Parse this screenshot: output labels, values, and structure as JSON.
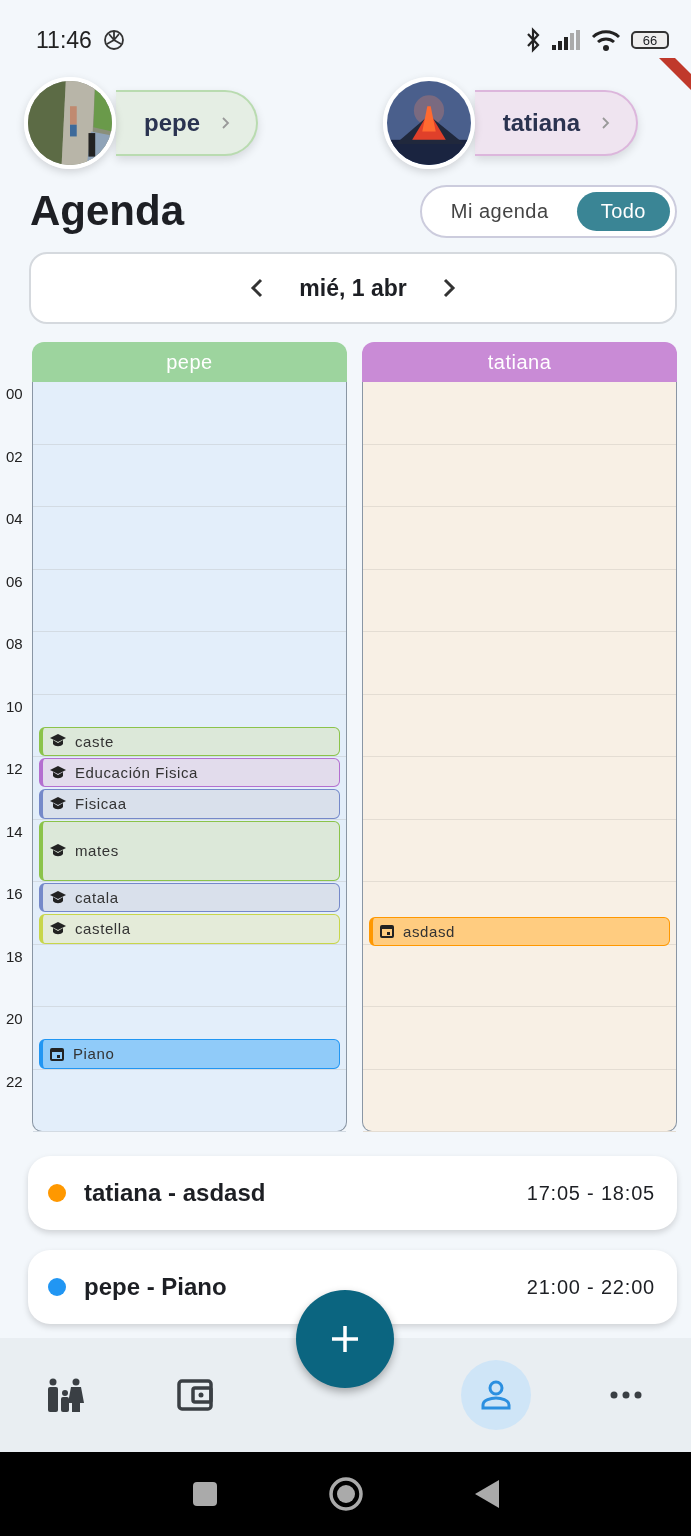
{
  "status_bar": {
    "time": "11:46",
    "battery": "66"
  },
  "profiles": [
    {
      "name": "pepe",
      "color": "#b9dbb0"
    },
    {
      "name": "tatiana",
      "color": "#dcb6dc"
    }
  ],
  "title": "Agenda",
  "view_toggle": [
    {
      "label": "Mi agenda",
      "selected": false
    },
    {
      "label": "Todo",
      "selected": true
    }
  ],
  "date_nav": {
    "date": "mié, 1 abr"
  },
  "hours": [
    "00",
    "02",
    "04",
    "06",
    "08",
    "10",
    "12",
    "14",
    "16",
    "18",
    "20",
    "22"
  ],
  "columns": [
    {
      "name": "pepe",
      "color": "#9dd49e",
      "events": [
        {
          "kind": "class",
          "title": "caste",
          "color": "#8bc34a"
        },
        {
          "kind": "class",
          "title": "Educación Fisica",
          "color": "#b46fd0"
        },
        {
          "kind": "class",
          "title": "Fisicaa",
          "color": "#7589c9"
        },
        {
          "kind": "class",
          "title": "mates",
          "color": "#8bc34a"
        },
        {
          "kind": "class",
          "title": "catala",
          "color": "#7589c9"
        },
        {
          "kind": "class",
          "title": "castella",
          "color": "#c8d64a"
        },
        {
          "kind": "event",
          "title": "Piano",
          "color": "#2196f3"
        }
      ]
    },
    {
      "name": "tatiana",
      "color": "#c98bd6",
      "events": [
        {
          "kind": "event",
          "title": "asdasd",
          "color": "#ff9800"
        }
      ]
    }
  ],
  "summary": [
    {
      "title": "tatiana - asdasd",
      "time": "17:05 - 18:05",
      "color": "#ff9800"
    },
    {
      "title": "pepe - Piano",
      "time": "21:00 - 22:00",
      "color": "#2196f3"
    }
  ],
  "bottom_nav": [
    {
      "selected": false
    },
    {
      "selected": false
    },
    {
      "selected": true
    },
    {
      "selected": false
    }
  ]
}
